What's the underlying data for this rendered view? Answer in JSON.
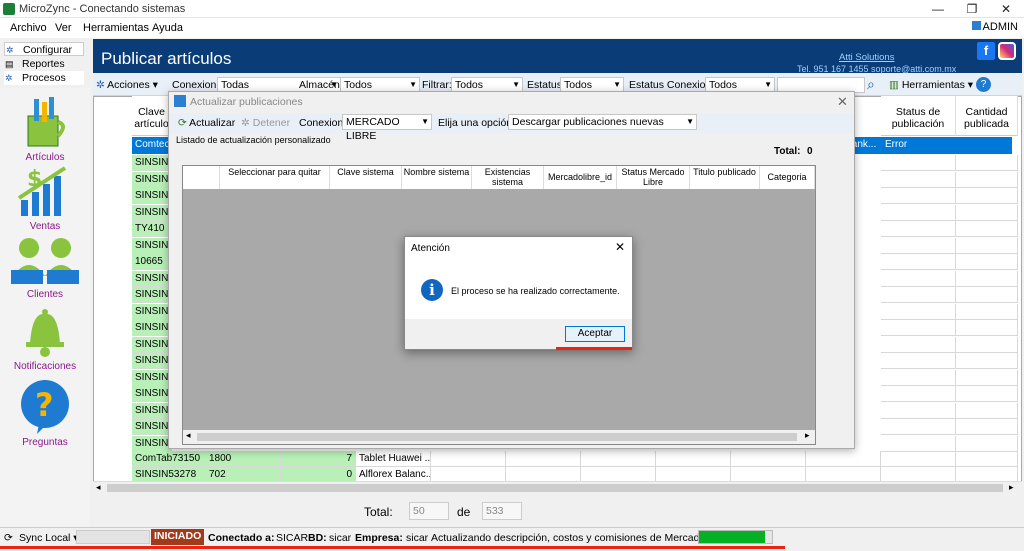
{
  "window": {
    "title": "MicroZync - Conectando sistemas",
    "user": "ADMIN"
  },
  "menu": [
    "Archivo",
    "Ver",
    "Herramientas",
    "Ayuda"
  ],
  "nav_tabs": [
    "Configurar",
    "Reportes",
    "Procesos"
  ],
  "sidebar": [
    "Artículos",
    "Ventas",
    "Clientes",
    "Notificaciones",
    "Preguntas"
  ],
  "header": {
    "title": "Publicar artículos",
    "company": "Atti Solutions",
    "contact": "Tel. 951 167 1455 soporte@atti.com.mx"
  },
  "toolbar": {
    "acciones": "Acciones",
    "conexion_label": "Conexion:",
    "conexion_value": "Todas",
    "almacen_label": "Almacén:",
    "almacen_value": "Todos",
    "filtrar_label": "Filtrar:",
    "filtrar_value": "Todos",
    "estatus_label": "Estatus",
    "estatus_value": "Todos",
    "estatus_conexion_label": "Estatus Conexion:",
    "estatus_conexion_value": "Todos",
    "herramientas": "Herramientas",
    "colors": {
      "header": "#0a3d78",
      "selection": "#0078d7",
      "row_green": "#b8f0b8"
    }
  },
  "grid": {
    "headers": [
      "Clave artículo",
      "Status de publicación",
      "Cantidad publicada"
    ],
    "selected_row": {
      "clave": "Comtec1",
      "tank": "tank...",
      "status": "Error"
    },
    "rows": [
      "SINSIN5",
      "SINSIN9",
      "SINSIN7",
      "SINSIN6",
      "TY410",
      "SINSIN5",
      "10665",
      "SINSIN5",
      "SINSIN4",
      "SINSIN6",
      "SINSIN3",
      "SINSIN9",
      "SINSIN9",
      "SINSIN3",
      "SINSIN8",
      "SINSIN3",
      "SINSIN6",
      "SINSIN1"
    ],
    "bottom_rows": [
      {
        "clave": "ComTab73150",
        "code": "1800",
        "qty": "7",
        "name": "Tablet Huawei ..."
      },
      {
        "clave": "SINSIN53278",
        "code": "702",
        "qty": "0",
        "name": "Alflorex Balanc..."
      }
    ]
  },
  "totals": {
    "label": "Total:",
    "value": "50",
    "of": "de",
    "total": "533"
  },
  "status": {
    "sync": "Sync Local",
    "iniciado": "INICIADO",
    "conectado_label": "Conectado a:",
    "conectado_value": "SICAR",
    "bd_label": "BD:",
    "bd_value": "sicar",
    "empresa_label": "Empresa:",
    "empresa_value": "sicar",
    "message": "Actualizando descripción, costos y comisiones de Mercado Libre",
    "progress": 0.9
  },
  "dialog": {
    "title": "Actualizar publicaciones",
    "actualizar": "Actualizar",
    "detener": "Detener",
    "conexion_label": "Conexion:",
    "conexion_value": "MERCADO LIBRE",
    "opcion_label": "Elija una opción:",
    "opcion_value": "Descargar publicaciones nuevas",
    "subtitle": "Listado de actualización personalizado",
    "total_label": "Total:",
    "total_value": "0",
    "columns": [
      "Seleccionar para quitar",
      "Clave sistema",
      "Nombre sistema",
      "Existencias sistema",
      "Mercadolibre_id",
      "Status Mercado Libre",
      "Titulo publicado",
      "Categoria"
    ]
  },
  "alert": {
    "title": "Atención",
    "message": "El proceso se ha realizado correctamente.",
    "ok": "Aceptar"
  }
}
